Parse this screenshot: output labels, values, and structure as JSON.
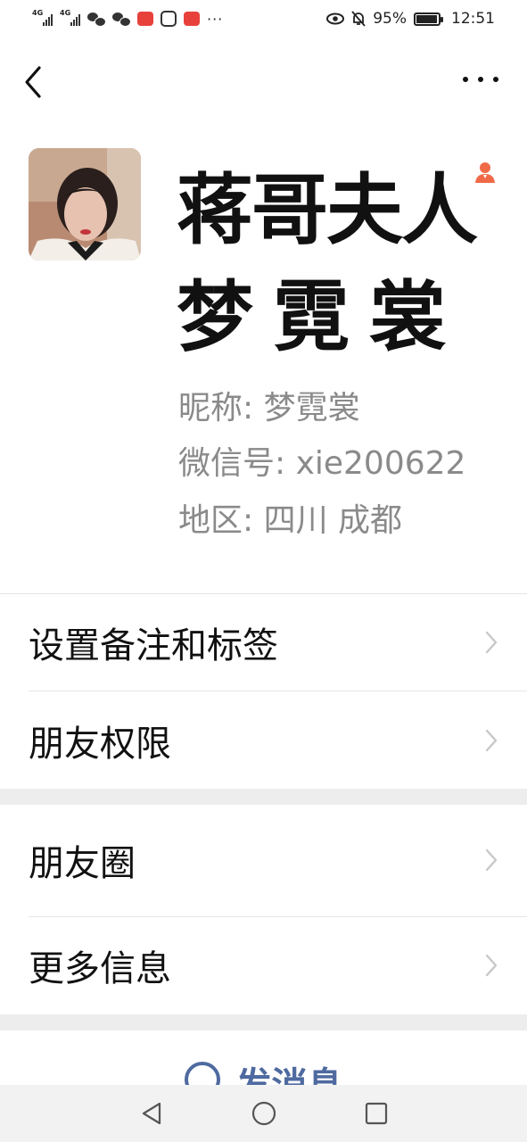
{
  "status_bar": {
    "network_1": "4G",
    "network_2": "4G",
    "battery_percent": "95%",
    "battery_level": 0.95,
    "time": "12:51"
  },
  "top_nav": {
    "back_icon": "chevron-left-icon",
    "more_icon": "more-dots-icon"
  },
  "profile": {
    "display_name_line1": "蒋哥夫人",
    "display_name_line2": "梦霓裳",
    "nickname": "昵称: 梦霓裳",
    "wechat_id": "微信号: xie200622",
    "region": "地区: 四川  成都",
    "badge_icon": "person-icon",
    "badge_color": "#f06a48"
  },
  "menu_group_1": [
    {
      "label": "设置备注和标签"
    },
    {
      "label": "朋友权限"
    }
  ],
  "menu_group_2": [
    {
      "label": "朋友圈"
    },
    {
      "label": "更多信息"
    }
  ],
  "actions": {
    "send_message": "发消息",
    "accent_color": "#4f6aa0"
  },
  "system_nav": {
    "back": "triangle-back-icon",
    "home": "circle-home-icon",
    "recents": "square-recents-icon"
  }
}
